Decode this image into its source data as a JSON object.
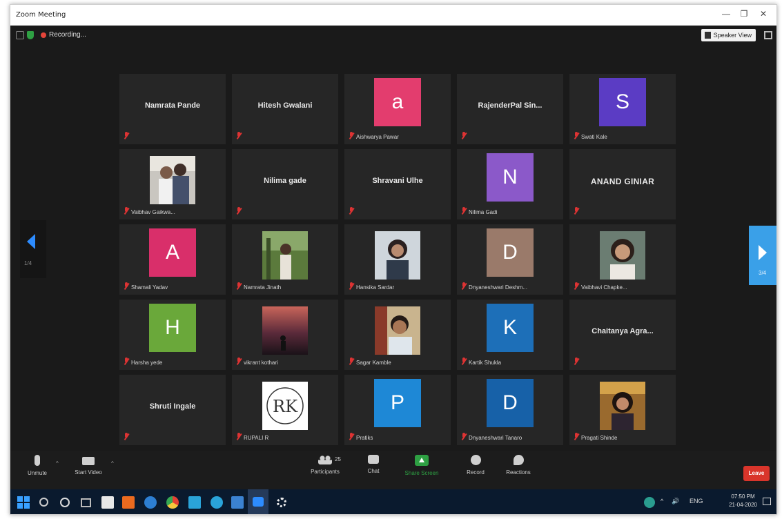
{
  "window": {
    "title": "Zoom Meeting",
    "minimize": "—",
    "restore": "❐",
    "close": "✕"
  },
  "topbar": {
    "recording_label": "Recording...",
    "speaker_view_label": "Speaker View",
    "fullscreen_icon": "fullscreen-icon"
  },
  "pagination": {
    "prev_page": "1/4",
    "next_page": "3/4"
  },
  "participants": [
    {
      "kind": "name",
      "name": "Namrata Pande",
      "label": ""
    },
    {
      "kind": "name",
      "name": "Hitesh Gwalani",
      "label": ""
    },
    {
      "kind": "avatar",
      "letter": "a",
      "color": "#e33d6e",
      "label": "Aishwarya Pawar"
    },
    {
      "kind": "name",
      "name": "RajenderPal Sin...",
      "label": ""
    },
    {
      "kind": "avatar",
      "letter": "S",
      "color": "#5b3cc4",
      "label": "Swati Kale"
    },
    {
      "kind": "photo",
      "photo": "couple",
      "label": "Vaibhav Gaikwa..."
    },
    {
      "kind": "name",
      "name": "Nilima gade",
      "label": ""
    },
    {
      "kind": "name",
      "name": "Shravani Ulhe",
      "label": ""
    },
    {
      "kind": "avatar",
      "letter": "N",
      "color": "#8b59c9",
      "label": "Nilima Gadi"
    },
    {
      "kind": "name",
      "name": "ANAND GINIAR",
      "label": ""
    },
    {
      "kind": "avatar",
      "letter": "A",
      "color": "#d92f6a",
      "label": "Shamali Yadav"
    },
    {
      "kind": "photo",
      "photo": "outdoor",
      "label": "Namrata Jinath"
    },
    {
      "kind": "photo",
      "photo": "woman1",
      "label": "Hansika Sardar"
    },
    {
      "kind": "avatar",
      "letter": "D",
      "color": "#9a7a6a",
      "label": "Dnyaneshwari Deshm..."
    },
    {
      "kind": "photo",
      "photo": "woman2",
      "label": "Vaibhavi Chapke..."
    },
    {
      "kind": "avatar",
      "letter": "H",
      "color": "#6aa83a",
      "label": "Harsha yede"
    },
    {
      "kind": "photo",
      "photo": "dusk",
      "label": "vikrant kothari"
    },
    {
      "kind": "photo",
      "photo": "man",
      "label": "Sagar Kamble"
    },
    {
      "kind": "avatar",
      "letter": "K",
      "color": "#1d6fb8",
      "label": "Kartik Shukla"
    },
    {
      "kind": "name",
      "name": "Chaitanya Agra...",
      "label": ""
    },
    {
      "kind": "name",
      "name": "Shruti Ingale",
      "label": ""
    },
    {
      "kind": "photo",
      "photo": "logo",
      "logo_text": "RK",
      "label": "RUPALI R"
    },
    {
      "kind": "avatar",
      "letter": "P",
      "color": "#1e88d6",
      "label": "Pratiks"
    },
    {
      "kind": "avatar",
      "letter": "D",
      "color": "#1761a8",
      "label": "Dnyaneshwari Tanaro"
    },
    {
      "kind": "photo",
      "photo": "woman3",
      "label": "Pragati Shinde"
    }
  ],
  "controls": {
    "unmute": "Unmute",
    "start_video": "Start Video",
    "participants": "Participants",
    "participants_count": "25",
    "chat": "Chat",
    "share_screen": "Share Screen",
    "record": "Record",
    "reactions": "Reactions",
    "leave": "Leave"
  },
  "taskbar": {
    "tray_chevron": "^",
    "tray_lang": "ENG",
    "time": "07:50 PM",
    "date": "21-04-2020"
  }
}
